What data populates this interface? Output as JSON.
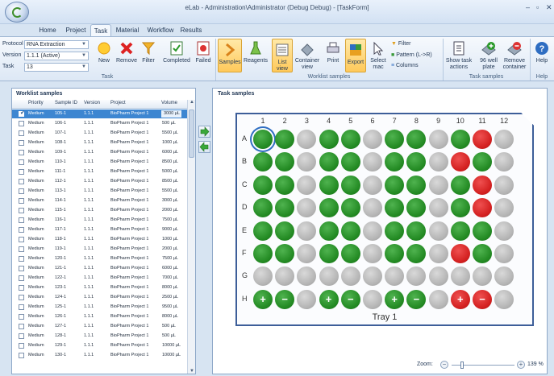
{
  "window": {
    "title": "eLab - Administration\\Administrator (Debug Debug) - [TaskForm]",
    "controls": [
      "–",
      "▫",
      "✕"
    ]
  },
  "tabs": [
    {
      "label": "Home",
      "active": false
    },
    {
      "label": "Project",
      "active": false
    },
    {
      "label": "Task",
      "active": true
    },
    {
      "label": "Material",
      "active": false
    },
    {
      "label": "Workflow",
      "active": false
    },
    {
      "label": "Results",
      "active": false
    }
  ],
  "ribbon": {
    "task_group": {
      "protocol_label": "Protocol",
      "protocol_value": "RNA Extraction",
      "version_label": "Version",
      "version_value": "1.1.1 (Active)",
      "task_label": "Task",
      "task_value": "13",
      "buttons": [
        "New",
        "Remove",
        "Filter",
        "Completed",
        "Failed"
      ],
      "group_label": "Task"
    },
    "worklist_group": {
      "buttons": [
        "Samples",
        "Reagents",
        "List view",
        "Container view",
        "Print",
        "Export",
        "Select mac"
      ],
      "small_buttons": [
        "Filter",
        "Pattern (L->R)",
        "Columns"
      ],
      "group_label": "Worklist samples"
    },
    "task_samples_group": {
      "buttons": [
        "Show task actions",
        "96 well plate",
        "Remove container"
      ],
      "group_label": "Task samples"
    },
    "help_group": {
      "buttons": [
        "Help"
      ],
      "group_label": "Help"
    }
  },
  "worklist": {
    "title": "Worklist samples",
    "columns": [
      "Priority",
      "Sample ID",
      "Version",
      "Project",
      "Volume"
    ],
    "rows": [
      {
        "checked": true,
        "priority": "Medium",
        "id": "105-1",
        "version": "1.1.1",
        "project": "BioPharm Project 1",
        "volume": "3000 µL"
      },
      {
        "checked": false,
        "priority": "Medium",
        "id": "106-1",
        "version": "1.1.1",
        "project": "BioPharm Project 1",
        "volume": "500 µL"
      },
      {
        "checked": false,
        "priority": "Medium",
        "id": "107-1",
        "version": "1.1.1",
        "project": "BioPharm Project 1",
        "volume": "5500 µL"
      },
      {
        "checked": false,
        "priority": "Medium",
        "id": "108-1",
        "version": "1.1.1",
        "project": "BioPharm Project 1",
        "volume": "1000 µL"
      },
      {
        "checked": false,
        "priority": "Medium",
        "id": "109-1",
        "version": "1.1.1",
        "project": "BioPharm Project 1",
        "volume": "6000 µL"
      },
      {
        "checked": false,
        "priority": "Medium",
        "id": "110-1",
        "version": "1.1.1",
        "project": "BioPharm Project 1",
        "volume": "8500 µL"
      },
      {
        "checked": false,
        "priority": "Medium",
        "id": "111-1",
        "version": "1.1.1",
        "project": "BioPharm Project 1",
        "volume": "5000 µL"
      },
      {
        "checked": false,
        "priority": "Medium",
        "id": "112-1",
        "version": "1.1.1",
        "project": "BioPharm Project 1",
        "volume": "8500 µL"
      },
      {
        "checked": false,
        "priority": "Medium",
        "id": "113-1",
        "version": "1.1.1",
        "project": "BioPharm Project 1",
        "volume": "5500 µL"
      },
      {
        "checked": false,
        "priority": "Medium",
        "id": "114-1",
        "version": "1.1.1",
        "project": "BioPharm Project 1",
        "volume": "3000 µL"
      },
      {
        "checked": false,
        "priority": "Medium",
        "id": "115-1",
        "version": "1.1.1",
        "project": "BioPharm Project 1",
        "volume": "2000 µL"
      },
      {
        "checked": false,
        "priority": "Medium",
        "id": "116-1",
        "version": "1.1.1",
        "project": "BioPharm Project 1",
        "volume": "7500 µL"
      },
      {
        "checked": false,
        "priority": "Medium",
        "id": "117-1",
        "version": "1.1.1",
        "project": "BioPharm Project 1",
        "volume": "9000 µL"
      },
      {
        "checked": false,
        "priority": "Medium",
        "id": "118-1",
        "version": "1.1.1",
        "project": "BioPharm Project 1",
        "volume": "1000 µL"
      },
      {
        "checked": false,
        "priority": "Medium",
        "id": "119-1",
        "version": "1.1.1",
        "project": "BioPharm Project 1",
        "volume": "2000 µL"
      },
      {
        "checked": false,
        "priority": "Medium",
        "id": "120-1",
        "version": "1.1.1",
        "project": "BioPharm Project 1",
        "volume": "7500 µL"
      },
      {
        "checked": false,
        "priority": "Medium",
        "id": "121-1",
        "version": "1.1.1",
        "project": "BioPharm Project 1",
        "volume": "6000 µL"
      },
      {
        "checked": false,
        "priority": "Medium",
        "id": "122-1",
        "version": "1.1.1",
        "project": "BioPharm Project 1",
        "volume": "7000 µL"
      },
      {
        "checked": false,
        "priority": "Medium",
        "id": "123-1",
        "version": "1.1.1",
        "project": "BioPharm Project 1",
        "volume": "8000 µL"
      },
      {
        "checked": false,
        "priority": "Medium",
        "id": "124-1",
        "version": "1.1.1",
        "project": "BioPharm Project 1",
        "volume": "2500 µL"
      },
      {
        "checked": false,
        "priority": "Medium",
        "id": "125-1",
        "version": "1.1.1",
        "project": "BioPharm Project 1",
        "volume": "9500 µL"
      },
      {
        "checked": false,
        "priority": "Medium",
        "id": "126-1",
        "version": "1.1.1",
        "project": "BioPharm Project 1",
        "volume": "8000 µL"
      },
      {
        "checked": false,
        "priority": "Medium",
        "id": "127-1",
        "version": "1.1.1",
        "project": "BioPharm Project 1",
        "volume": "500 µL"
      },
      {
        "checked": false,
        "priority": "Medium",
        "id": "128-1",
        "version": "1.1.1",
        "project": "BioPharm Project 1",
        "volume": "500 µL"
      },
      {
        "checked": false,
        "priority": "Medium",
        "id": "129-1",
        "version": "1.1.1",
        "project": "BioPharm Project 1",
        "volume": "10000 µL"
      },
      {
        "checked": false,
        "priority": "Medium",
        "id": "130-1",
        "version": "1.1.1",
        "project": "BioPharm Project 1",
        "volume": "10000 µL"
      }
    ]
  },
  "task_samples": {
    "title": "Task samples",
    "tray_name": "Tray 1",
    "columns": [
      "1",
      "2",
      "3",
      "4",
      "5",
      "6",
      "7",
      "8",
      "9",
      "10",
      "11",
      "12"
    ],
    "row_labels": [
      "A",
      "B",
      "C",
      "D",
      "E",
      "F",
      "G",
      "H"
    ],
    "wells": [
      "GGXGGXGGXGRX",
      "GGXGGXGGXRGX",
      "GGXGGXGGXGRX",
      "GGXGGXGGXGRX",
      "GGXGGXGGXGGX",
      "GGXGGXGGXRGX",
      "XXXXXXXXXXXX",
      "GGXGGXGGXRRX"
    ],
    "well_labels": {
      "H1": "+",
      "H2": "−",
      "H4": "+",
      "H5": "−",
      "H7": "+",
      "H8": "−",
      "H10": "+",
      "H11": "−"
    },
    "selected_well": "A1",
    "colors": {
      "filled": "#238a23",
      "control": "#d32020",
      "empty": "#b4b4b4"
    }
  },
  "zoom": {
    "label": "Zoom:",
    "value": "139 %",
    "level": 0.14
  }
}
